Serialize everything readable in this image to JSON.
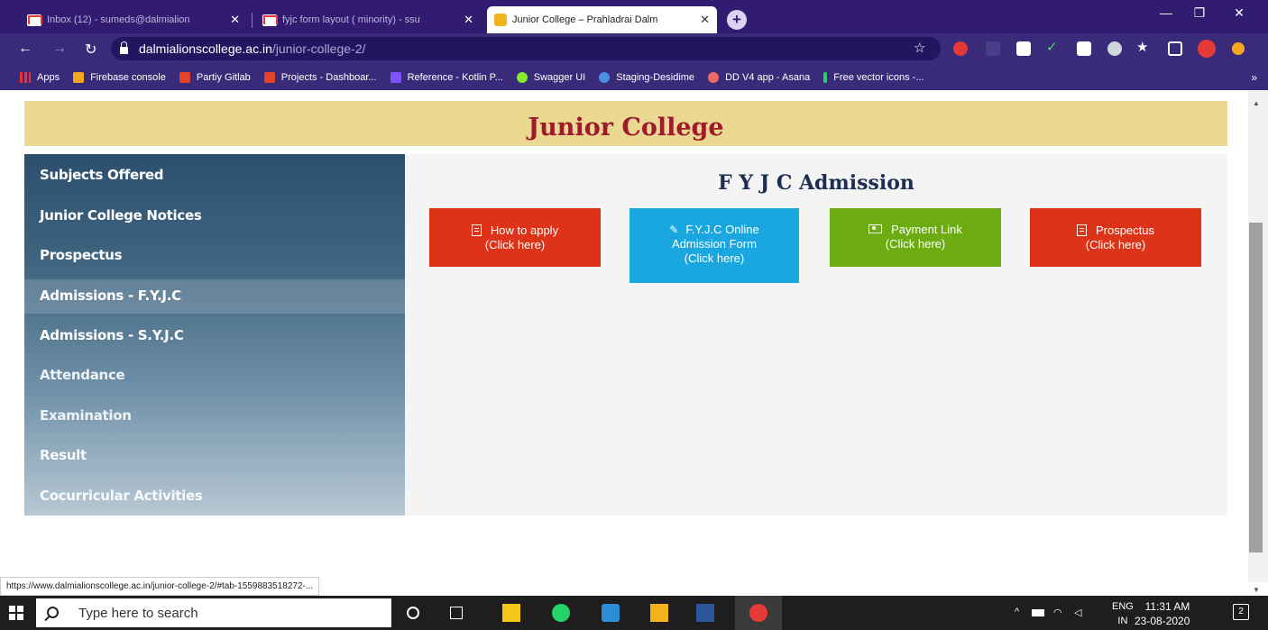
{
  "browser": {
    "tabs": [
      {
        "title": "Inbox (12) - sumeds@dalmialion",
        "icon": "gmail-icon"
      },
      {
        "title": "fyjc form layout ( minority) - ssu",
        "icon": "gmail-icon"
      },
      {
        "title": "Junior College – Prahladrai Dalm",
        "icon": "college-logo-icon"
      }
    ],
    "new_tab_label": "+",
    "url_host": "dalmialionscollege.ac.in",
    "url_path": "/junior-college-2/",
    "bookmarks": [
      {
        "label": "Apps",
        "icon": "apps-grid-icon",
        "color": "#e53935"
      },
      {
        "label": "Firebase console",
        "icon": "firebase-icon",
        "color": "#f5a623"
      },
      {
        "label": "Partiy Gitlab",
        "icon": "gitlab-icon",
        "color": "#e24329"
      },
      {
        "label": "Projects - Dashboar...",
        "icon": "gitlab-icon",
        "color": "#e24329"
      },
      {
        "label": "Reference - Kotlin P...",
        "icon": "kotlin-icon",
        "color": "#7f52ff"
      },
      {
        "label": "Swagger UI",
        "icon": "swagger-icon",
        "color": "#85ea2d"
      },
      {
        "label": "Staging-Desidime",
        "icon": "desidime-icon",
        "color": "#4a90e2"
      },
      {
        "label": "DD V4 app - Asana",
        "icon": "asana-icon",
        "color": "#f06a6a"
      },
      {
        "label": "Free vector icons -...",
        "icon": "flaticon-icon",
        "color": "#2ecc71"
      }
    ],
    "bookmarks_more": "»",
    "status_url": "https://www.dalmialionscollege.ac.in/junior-college-2/#tab-1559883518272-..."
  },
  "page": {
    "banner_title": "Junior College",
    "sidebar": [
      {
        "label": "Subjects Offered"
      },
      {
        "label": "Junior College Notices"
      },
      {
        "label": "Prospectus"
      },
      {
        "label": "Admissions - F.Y.J.C",
        "active": true
      },
      {
        "label": "Admissions - S.Y.J.C"
      },
      {
        "label": "Attendance"
      },
      {
        "label": "Examination"
      },
      {
        "label": "Result"
      },
      {
        "label": "Cocurricular Activities"
      }
    ],
    "main_heading": "F Y J C Admission",
    "buttons": [
      {
        "line1": "How to apply",
        "line2": "(Click here)",
        "line3": "",
        "icon": "document-icon",
        "color": "#dd3318"
      },
      {
        "line1": "F.Y.J.C Online",
        "line2": "Admission Form",
        "line3": "(Click here)",
        "icon": "pencil-icon",
        "color": "#1aa7e0"
      },
      {
        "line1": "Payment Link",
        "line2": "(Click here)",
        "line3": "",
        "icon": "money-icon",
        "color": "#6cab12"
      },
      {
        "line1": "Prospectus",
        "line2": "(Click here)",
        "line3": "",
        "icon": "document-icon",
        "color": "#dd3318"
      }
    ]
  },
  "taskbar": {
    "search_placeholder": "Type here to search",
    "lang_line1": "ENG",
    "lang_line2": "IN",
    "time": "11:31 AM",
    "date": "23-08-2020",
    "notification_count": "2"
  }
}
